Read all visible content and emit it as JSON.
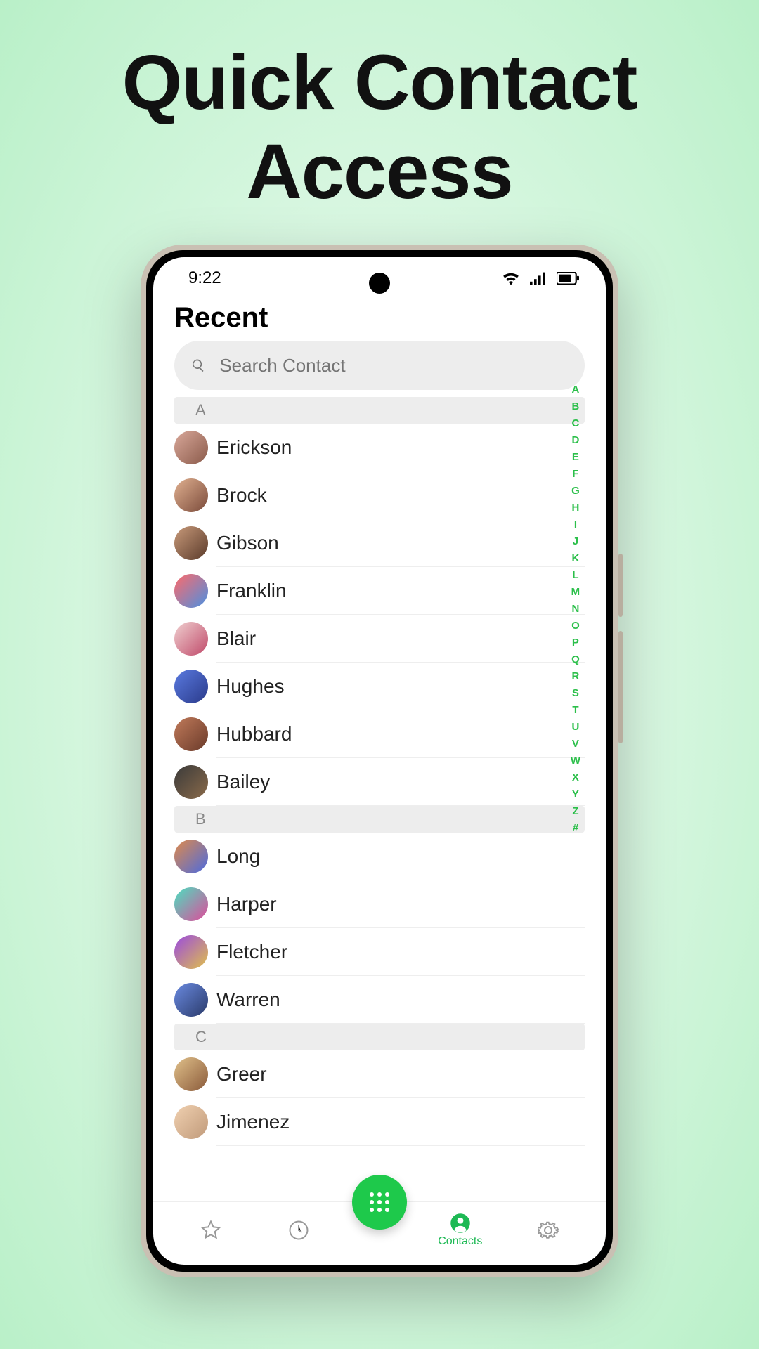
{
  "promo": {
    "line1": "Quick Contact",
    "line2": "Access"
  },
  "status": {
    "time": "9:22"
  },
  "header": {
    "title": "Recent"
  },
  "search": {
    "placeholder": "Search Contact"
  },
  "alpha_index": [
    "A",
    "B",
    "C",
    "D",
    "E",
    "F",
    "G",
    "H",
    "I",
    "J",
    "K",
    "L",
    "M",
    "N",
    "O",
    "P",
    "Q",
    "R",
    "S",
    "T",
    "U",
    "V",
    "W",
    "X",
    "Y",
    "Z",
    "#"
  ],
  "sections": [
    {
      "letter": "A",
      "contacts": [
        {
          "name": "Erickson",
          "c1": "#d9a89a",
          "c2": "#8a5a4a"
        },
        {
          "name": "Brock",
          "c1": "#e0b090",
          "c2": "#7a4a3a"
        },
        {
          "name": "Gibson",
          "c1": "#c89a7a",
          "c2": "#5a3a2a"
        },
        {
          "name": "Franklin",
          "c1": "#ff6a6a",
          "c2": "#4a90e2"
        },
        {
          "name": "Blair",
          "c1": "#f0d0d0",
          "c2": "#c04a6a"
        },
        {
          "name": "Hughes",
          "c1": "#5a7ae0",
          "c2": "#2a3a8a"
        },
        {
          "name": "Hubbard",
          "c1": "#c07a5a",
          "c2": "#6a3a2a"
        },
        {
          "name": "Bailey",
          "c1": "#3a3a3a",
          "c2": "#8a6a4a"
        }
      ]
    },
    {
      "letter": "B",
      "contacts": [
        {
          "name": "Long",
          "c1": "#e08a4a",
          "c2": "#4a6ae0"
        },
        {
          "name": "Harper",
          "c1": "#4ae0c0",
          "c2": "#e04a9a"
        },
        {
          "name": "Fletcher",
          "c1": "#9a4ae0",
          "c2": "#e0c04a"
        },
        {
          "name": "Warren",
          "c1": "#6a8ae0",
          "c2": "#2a3a6a"
        }
      ]
    },
    {
      "letter": "C",
      "contacts": [
        {
          "name": "Greer",
          "c1": "#e0c08a",
          "c2": "#8a5a3a"
        },
        {
          "name": "Jimenez",
          "c1": "#f0d0b0",
          "c2": "#c09a7a"
        }
      ]
    }
  ],
  "nav": {
    "favorites": "Favorites",
    "recent": "Recent",
    "contacts": "Contacts",
    "settings": "Settings",
    "active": "contacts"
  }
}
